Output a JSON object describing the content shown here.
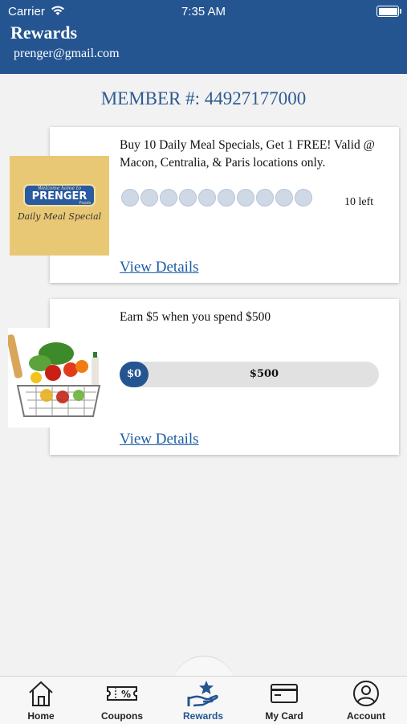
{
  "status_bar": {
    "carrier": "Carrier",
    "time": "7:35 AM"
  },
  "header": {
    "title": "Rewards",
    "email": "prenger@gmail.com"
  },
  "member": {
    "label": "MEMBER #: 44927177000"
  },
  "offers": [
    {
      "logo": {
        "line1": "Welcome home to",
        "brand": "PRENGER",
        "brand_sub": "Foods",
        "script": "Daily Meal Special"
      },
      "text": "Buy 10 Daily Meal Specials, Get 1 FREE! Valid @ Macon, Centralia, & Paris locations only.",
      "punches_total": 10,
      "punches_filled": 0,
      "left_label": "10 left",
      "link": "View Details"
    },
    {
      "image_icon": "grocery-basket-icon",
      "text": "Earn $5 when you spend $500",
      "progress_start": "$0",
      "progress_end": "$500",
      "progress_fraction": 0,
      "link": "View Details"
    }
  ],
  "tabs": [
    {
      "label": "Home",
      "icon": "home-icon"
    },
    {
      "label": "Coupons",
      "icon": "coupon-icon"
    },
    {
      "label": "Rewards",
      "icon": "rewards-icon",
      "active": true
    },
    {
      "label": "My Card",
      "icon": "card-icon"
    },
    {
      "label": "Account",
      "icon": "account-icon"
    }
  ],
  "colors": {
    "primary": "#245591",
    "link": "#1d5ea7",
    "background": "#f2f2f2"
  }
}
